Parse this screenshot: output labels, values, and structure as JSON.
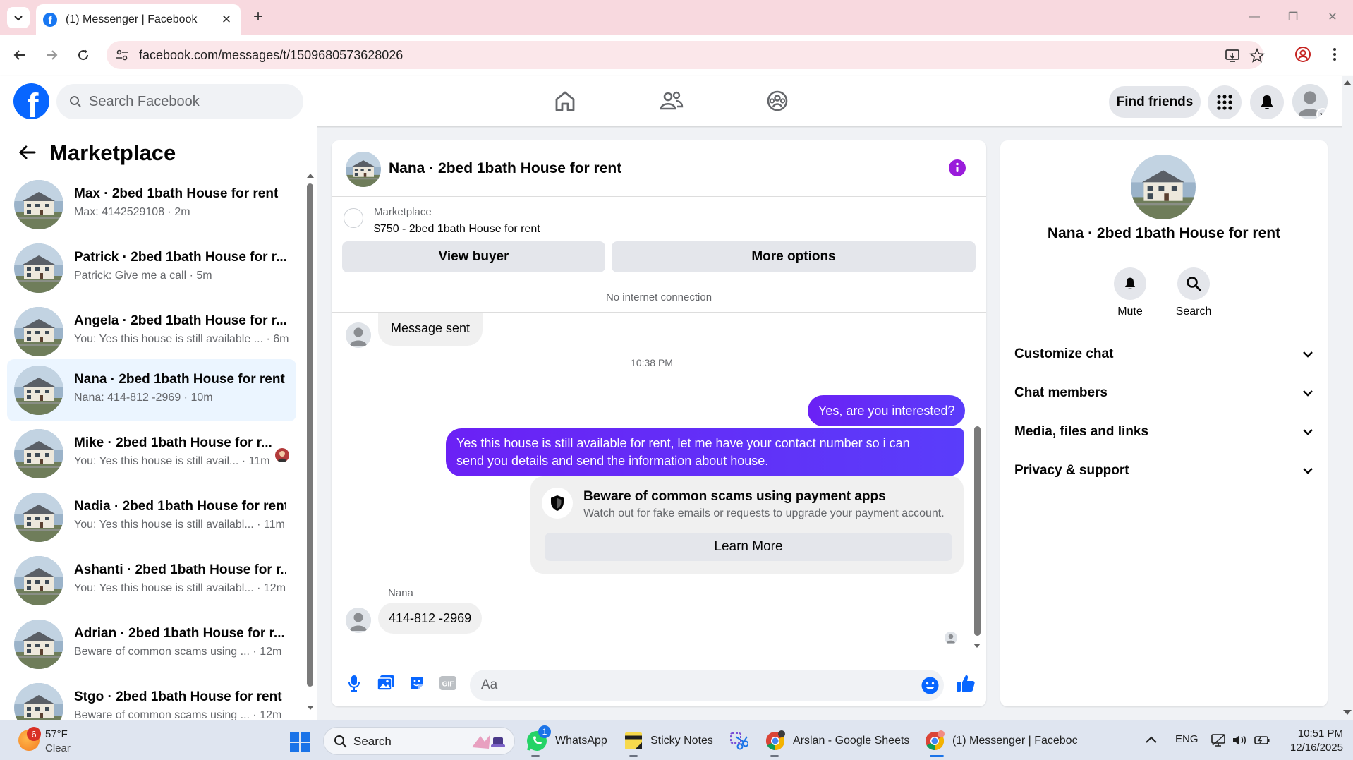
{
  "browser": {
    "tab_title": "(1) Messenger | Facebook",
    "url": "facebook.com/messages/t/1509680573628026"
  },
  "fb_header": {
    "search_placeholder": "Search Facebook",
    "find_friends": "Find friends"
  },
  "sidebar": {
    "title": "Marketplace",
    "conversations": [
      {
        "name": "Max · 2bed 1bath House for rent",
        "preview": "Max: 4142529108 · 2m"
      },
      {
        "name": "Patrick · 2bed 1bath House for r...",
        "preview": "Patrick: Give me a call · 5m"
      },
      {
        "name": "Angela · 2bed 1bath House for r...",
        "preview": "You: Yes this house is still available ... · 6m"
      },
      {
        "name": "Nana · 2bed 1bath House for rent",
        "preview": "Nana: 414-812 -2969 · 10m"
      },
      {
        "name": "Mike · 2bed 1bath House for r...",
        "preview": "You: Yes this house is still avail... · 11m"
      },
      {
        "name": "Nadia · 2bed 1bath House for rent",
        "preview": "You: Yes this house is still availabl... · 11m"
      },
      {
        "name": "Ashanti · 2bed 1bath House for r...",
        "preview": "You: Yes this house is still availabl... · 12m"
      },
      {
        "name": "Adrian · 2bed 1bath House for r...",
        "preview": "Beware of common scams using ... · 12m"
      },
      {
        "name": "Stgo · 2bed 1bath House for rent",
        "preview": "Beware of common scams using ... · 12m"
      }
    ]
  },
  "chat": {
    "title": "Nana · 2bed 1bath House for rent",
    "marketplace_label": "Marketplace",
    "listing": "$750 - 2bed 1bath House for rent",
    "view_buyer": "View buyer",
    "more_options": "More options",
    "connection_status": "No internet connection",
    "messages": {
      "sent_notice": "Message sent",
      "timestamp": "10:38 PM",
      "out_1": "Yes, are you interested?",
      "out_2_line1": "Yes this house is still available for rent, let me have your contact number so i can",
      "out_2_line2": "send you details and send the information about house.",
      "scam_title": "Beware of common scams using payment apps",
      "scam_sub": "Watch out for fake emails or requests to upgrade your payment account.",
      "learn_more": "Learn More",
      "sender": "Nana",
      "in_phone": "414-812 -2969"
    },
    "composer_placeholder": "Aa"
  },
  "right_panel": {
    "name": "Nana · 2bed 1bath House for rent",
    "mute": "Mute",
    "search": "Search",
    "sections": [
      "Customize chat",
      "Chat members",
      "Media, files and links",
      "Privacy & support"
    ]
  },
  "taskbar": {
    "weather_badge": "6",
    "temperature": "57°F",
    "condition": "Clear",
    "search": "Search",
    "whatsapp_badge": "1",
    "apps": [
      "WhatsApp",
      "Sticky Notes",
      "Arslan - Google Sheets",
      "(1) Messenger | Faceboc"
    ],
    "language": "ENG",
    "time": "10:51 PM",
    "date": "12/16/2025"
  },
  "colors": {
    "fb_blue": "#0866ff",
    "messenger_purple": "#6b21f5",
    "active_conv_bg": "#ebf5ff"
  }
}
